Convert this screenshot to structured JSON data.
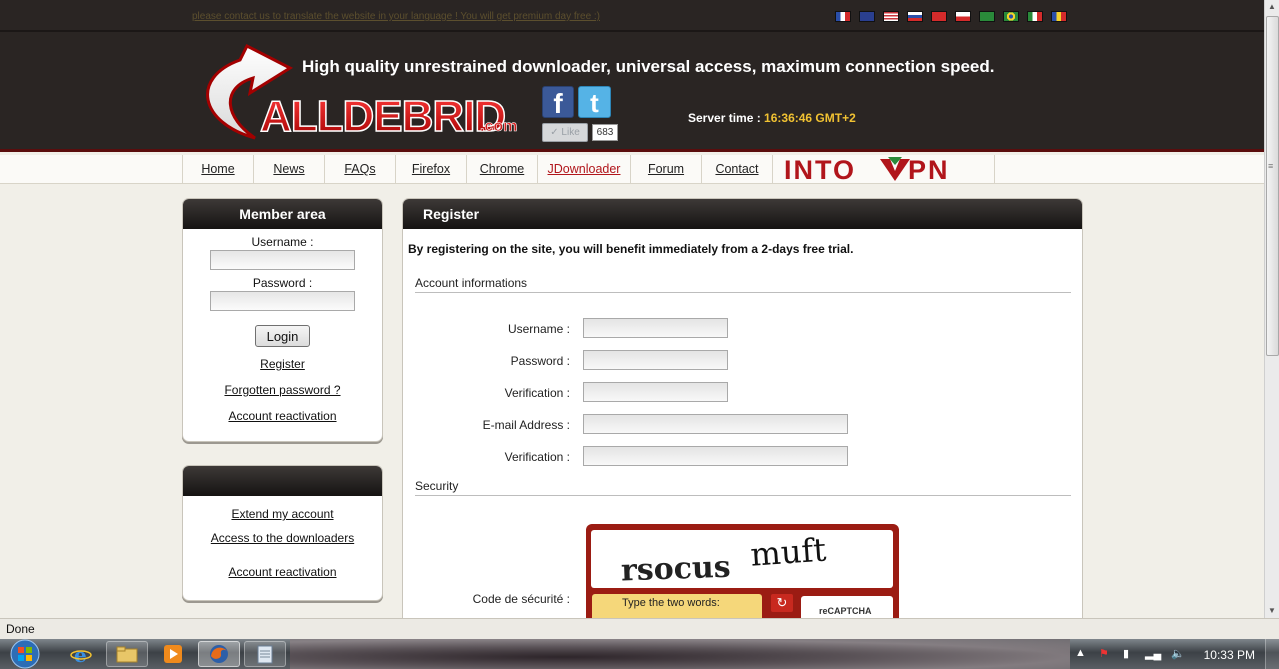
{
  "site": {
    "translate_notice": "please contact us to translate the website in your language ! You will get premium day free :)",
    "flags": [
      "fr",
      "eu",
      "us",
      "ru",
      "tr",
      "pl",
      "sa",
      "br",
      "it",
      "ro"
    ],
    "tagline": "High quality unrestrained downloader, universal access, maximum connection speed.",
    "logo_text": "ALLDEBRID.com",
    "social": {
      "facebook_icon": "facebook-icon",
      "twitter_icon": "twitter-icon",
      "like_label": "Like",
      "like_count": "683"
    },
    "server_time_label": "Server time :",
    "server_time_value": "16:36:46 GMT+2"
  },
  "nav": {
    "items": [
      {
        "label": "Home"
      },
      {
        "label": "News"
      },
      {
        "label": "FAQs"
      },
      {
        "label": "Firefox"
      },
      {
        "label": "Chrome"
      },
      {
        "label": "JDownloader"
      },
      {
        "label": "Forum"
      },
      {
        "label": "Contact"
      }
    ],
    "active_item": "JDownloader",
    "ad_text": "INTOVPN"
  },
  "member_area": {
    "title": "Member area",
    "username_label": "Username :",
    "password_label": "Password :",
    "login_button": "Login",
    "register_link": "Register",
    "forgot_link": "Forgotten password ?",
    "reactivation_link": "Account reactivation"
  },
  "account_box": {
    "title": "",
    "extend_link": "Extend my account",
    "downloaders_link": "Access to the downloaders",
    "reactivation_link": "Account reactivation"
  },
  "register": {
    "title": "Register",
    "intro": "By registering on the site, you will benefit immediately from a 2-days free trial.",
    "account_section": "Account informations",
    "fields": {
      "username": "Username :",
      "password": "Password :",
      "verification": "Verification :",
      "email": "E-mail Address :",
      "email_verification": "Verification :"
    },
    "security_section": "Security",
    "security_code_label": "Code de sécurité :",
    "captcha": {
      "word1": "rsocus",
      "word2": "muft",
      "prompt": "Type the two words:",
      "brand": "reCAPTCHA"
    }
  },
  "status_bar": {
    "text": "Done"
  },
  "taskbar": {
    "clock": "10:33 PM"
  },
  "colors": {
    "header_bg": "#2a2523",
    "accent_red": "#b1151b",
    "server_time": "#f1c232",
    "page_bg": "#f1efe8"
  }
}
